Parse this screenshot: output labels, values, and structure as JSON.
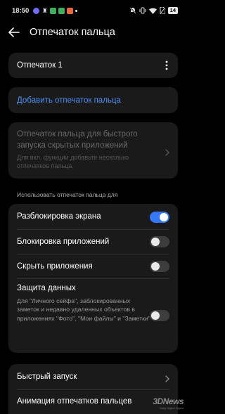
{
  "status_bar": {
    "time": "18:50",
    "battery": "14",
    "notification_icons": [
      {
        "icon": "app-icon",
        "color": "#6e6ef5"
      },
      {
        "icon": "figure-icon",
        "color": "#e8e8e8"
      },
      {
        "icon": "green-app-icon",
        "color": "#3fae5c"
      },
      {
        "icon": "green-app-icon",
        "color": "#3fae5c"
      },
      {
        "icon": "orange-app-icon",
        "color": "#e8673c"
      },
      {
        "icon": "dot-icon",
        "color": "#e8e8e8"
      }
    ]
  },
  "header": {
    "title": "Отпечаток пальца",
    "back_icon": "arrow-left-icon"
  },
  "fingerprint_card": {
    "label": "Отпечаток 1",
    "menu_icon": "more-vertical-icon"
  },
  "add_card": {
    "label": "Добавить отпечаток пальца"
  },
  "quick_launch_card": {
    "title": "Отпечаток пальца для быстрого запуска скрытых приложений",
    "subtitle": "Для вкл. функции добавьте несколько отпечатков пальца."
  },
  "usage_section": {
    "label": "Использовать отпечаток пальца для",
    "items": [
      {
        "label": "Разблокировка экрана",
        "enabled": true
      },
      {
        "label": "Блокировка приложений",
        "enabled": false
      },
      {
        "label": "Скрыть приложения",
        "enabled": false
      },
      {
        "label": "Защита данных",
        "enabled": false,
        "subtitle": "Для \"Личного сейфа\", заблокированных заметок и недавно удаленных объектов в приложениях \"Фото\", \"Мои файлы\" и \"Заметки\""
      }
    ]
  },
  "bottom_card": {
    "items": [
      {
        "label": "Быстрый запуск"
      },
      {
        "label": "Анимация отпечатков пальцев"
      }
    ]
  },
  "watermark": {
    "text": "3DNews",
    "small": "Daily Digital Digest"
  },
  "colors": {
    "accent": "#3478f6",
    "link": "#4d8ff5",
    "card": "#1a1a1a",
    "background": "#000000"
  }
}
